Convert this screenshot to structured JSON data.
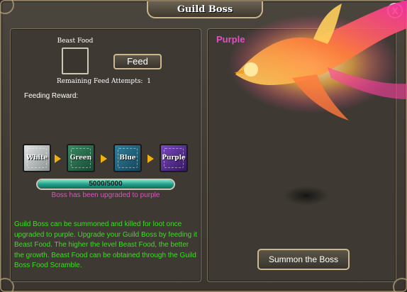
{
  "window": {
    "title": "Guild Boss",
    "close_label": "X"
  },
  "feed": {
    "beast_food_label": "Beast Food",
    "feed_button": "Feed",
    "remaining_label": "Remaining Feed Attempts:",
    "remaining_value": "1",
    "feeding_reward_label": "Feeding Reward:"
  },
  "tiers": [
    "White",
    "Green",
    "Blue",
    "Purple"
  ],
  "progress": {
    "text": "5000/5000",
    "fraction": 1.0
  },
  "status_text": "Boss has been upgraded to purple",
  "description": "Guild Boss can be summoned and killed for loot once upgraded to purple. Upgrade your Guild Boss by feeding it Beast Food. The higher the level Beast Food, the better the growth. Beast Food can be obtained through the Guild Boss Food Scramble.",
  "boss": {
    "grade_label": "Purple",
    "icon": "phoenix-icon"
  },
  "summon_button": "Summon the Boss",
  "colors": {
    "status": "#e24fc4",
    "description": "#38e01e",
    "progress": "#21a08a"
  }
}
